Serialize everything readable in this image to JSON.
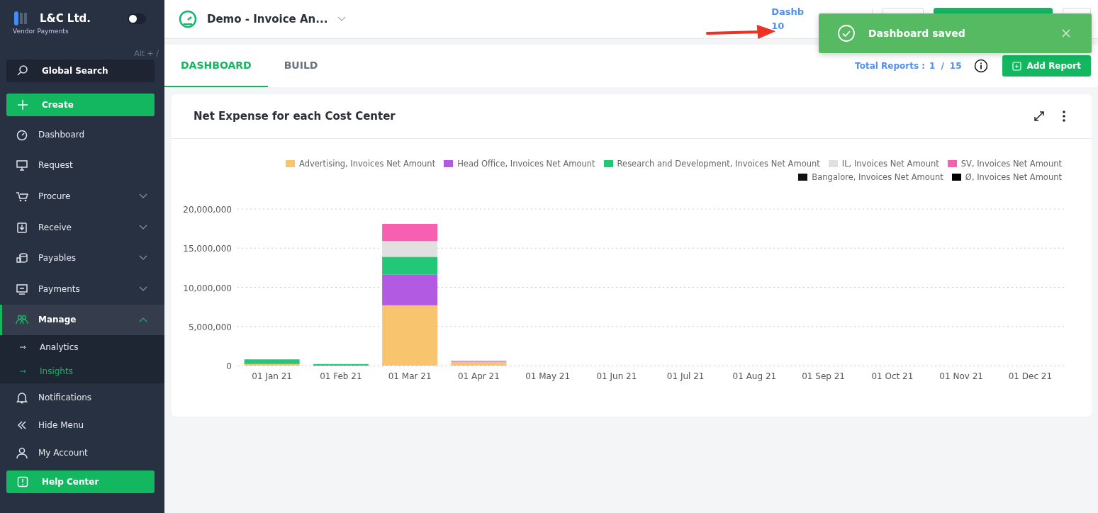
{
  "sidebar": {
    "brand": "L&C Ltd.",
    "subtitle": "Vendor Payments",
    "theme_toggle": {
      "on": false
    },
    "shortcut": "Alt + /",
    "search": {
      "label": "Global Search"
    },
    "create": {
      "label": "Create"
    },
    "items": [
      {
        "label": "Dashboard",
        "selected": false
      },
      {
        "label": "Request",
        "selected": false
      },
      {
        "label": "Procure",
        "selected": false,
        "expanded": false
      },
      {
        "label": "Receive",
        "selected": false,
        "expanded": false
      },
      {
        "label": "Payables",
        "selected": false,
        "expanded": false
      },
      {
        "label": "Payments",
        "selected": false,
        "expanded": false
      },
      {
        "label": "Manage",
        "selected": true,
        "expanded": true,
        "children": [
          {
            "label": "Analytics",
            "selected": false
          },
          {
            "label": "Insights",
            "selected": true
          }
        ]
      }
    ],
    "bottom_items": [
      {
        "label": "Notifications"
      },
      {
        "label": "Hide Menu"
      },
      {
        "label": "My Account"
      }
    ],
    "help": {
      "label": "Help Center"
    }
  },
  "header": {
    "title": "Demo - Invoice An...",
    "link_line_1": "Dashb",
    "link_line_2": "10"
  },
  "tabs": [
    {
      "label": "DASHBOARD",
      "selected": true
    },
    {
      "label": "BUILD",
      "selected": false
    }
  ],
  "total_reports": {
    "label": "Total Reports :",
    "current": "1",
    "separator": "/",
    "total": "15"
  },
  "add_report": {
    "label": "Add Report"
  },
  "card": {
    "title": "Net Expense for each Cost Center",
    "chart_data": {
      "type": "bar",
      "stacked": true,
      "grid": true,
      "categories": [
        "01 Jan 21",
        "01 Feb 21",
        "01 Mar 21",
        "01 Apr 21",
        "01 May 21",
        "01 Jun 21",
        "01 Jul 21",
        "01 Aug 21",
        "01 Sep 21",
        "01 Oct 21",
        "01 Nov 21",
        "01 Dec 21"
      ],
      "ylim": [
        0,
        20000000
      ],
      "yticks": [
        {
          "value": 0,
          "label": "0"
        },
        {
          "value": 5000000,
          "label": "5,000,000"
        },
        {
          "value": 10000000,
          "label": "10,000,000"
        },
        {
          "value": 15000000,
          "label": "15,000,000"
        },
        {
          "value": 20000000,
          "label": "20,000,000"
        }
      ],
      "series": [
        {
          "name": "Advertising, Invoices Net Amount",
          "color": "#f8c46e",
          "values": [
            200000,
            0,
            7700000,
            500000,
            0,
            0,
            0,
            0,
            0,
            0,
            0,
            0
          ]
        },
        {
          "name": "Head Office, Invoices Net Amount",
          "color": "#b25ae2",
          "values": [
            0,
            0,
            3900000,
            100000,
            0,
            0,
            0,
            0,
            0,
            0,
            0,
            0
          ]
        },
        {
          "name": "Research and Development, Invoices Net Amount",
          "color": "#22c777",
          "values": [
            600000,
            200000,
            2300000,
            0,
            0,
            0,
            0,
            0,
            0,
            0,
            0,
            0
          ]
        },
        {
          "name": "IL, Invoices Net Amount",
          "color": "#e0e0e0",
          "values": [
            0,
            0,
            2000000,
            0,
            0,
            0,
            0,
            0,
            0,
            0,
            0,
            0
          ]
        },
        {
          "name": "SV, Invoices Net Amount",
          "color": "#f760b0",
          "values": [
            0,
            0,
            2200000,
            0,
            0,
            0,
            0,
            0,
            0,
            0,
            0,
            0
          ]
        },
        {
          "name": "Bangalore, Invoices Net Amount",
          "color": "#111111",
          "values": [
            0,
            0,
            0,
            0,
            0,
            0,
            0,
            0,
            0,
            0,
            0,
            0
          ]
        },
        {
          "name": "Ø, Invoices Net Amount",
          "color": "#000000",
          "values": [
            0,
            0,
            0,
            0,
            0,
            0,
            0,
            0,
            0,
            0,
            0,
            0
          ]
        }
      ]
    }
  },
  "toast": {
    "message": "Dashboard saved"
  }
}
